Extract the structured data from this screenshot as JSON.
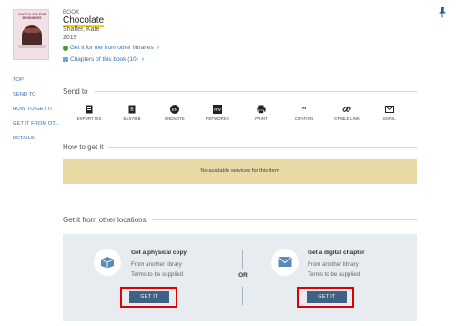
{
  "record": {
    "type_label": "BOOK",
    "title": "Chocolate",
    "author": "Shaffer, Kate",
    "year": "2019",
    "cover_title": "CHOCOLATE FOR BEGINNERS",
    "links": [
      {
        "label": "Get it for me from other libraries",
        "icon": "globe-icon"
      },
      {
        "label": "Chapters of this book (10)",
        "icon": "chapters-icon"
      }
    ]
  },
  "nav": {
    "items": [
      "TOP",
      "SEND TO",
      "HOW TO GET IT",
      "GET IT FROM OT...",
      "DETAILS"
    ]
  },
  "send_to": {
    "heading": "Send to",
    "items": [
      {
        "label": "EXPORT RIS",
        "icon": "export-ris-icon"
      },
      {
        "label": "EASYBIB",
        "icon": "easybib-icon"
      },
      {
        "label": "ENDNOTE",
        "icon": "endnote-icon",
        "glyph": "EN"
      },
      {
        "label": "REFWORKS",
        "icon": "refworks-icon",
        "glyph": "RW"
      },
      {
        "label": "PRINT",
        "icon": "print-icon"
      },
      {
        "label": "CITATION",
        "icon": "citation-icon"
      },
      {
        "label": "STABLE LINK",
        "icon": "link-icon"
      },
      {
        "label": "EMAIL",
        "icon": "email-icon"
      }
    ]
  },
  "how_to_get": {
    "heading": "How to get it",
    "message": "No available services for this item"
  },
  "other_locations": {
    "heading": "Get it from other locations",
    "or_label": "OR",
    "physical": {
      "title": "Get a physical copy",
      "line1": "From another library",
      "line2": "Terms to be supplied",
      "button": "GET IT"
    },
    "digital": {
      "title": "Get a digital chapter",
      "line1": "From another library",
      "line2": "Terms to be supplied",
      "button": "GET IT"
    }
  },
  "colors": {
    "link": "#3a6fb0",
    "banner": "#e8d9a5",
    "panel": "#e7ecf1",
    "button": "#3f6184",
    "highlight": "#e00000",
    "title_underline": "#f2d400"
  }
}
